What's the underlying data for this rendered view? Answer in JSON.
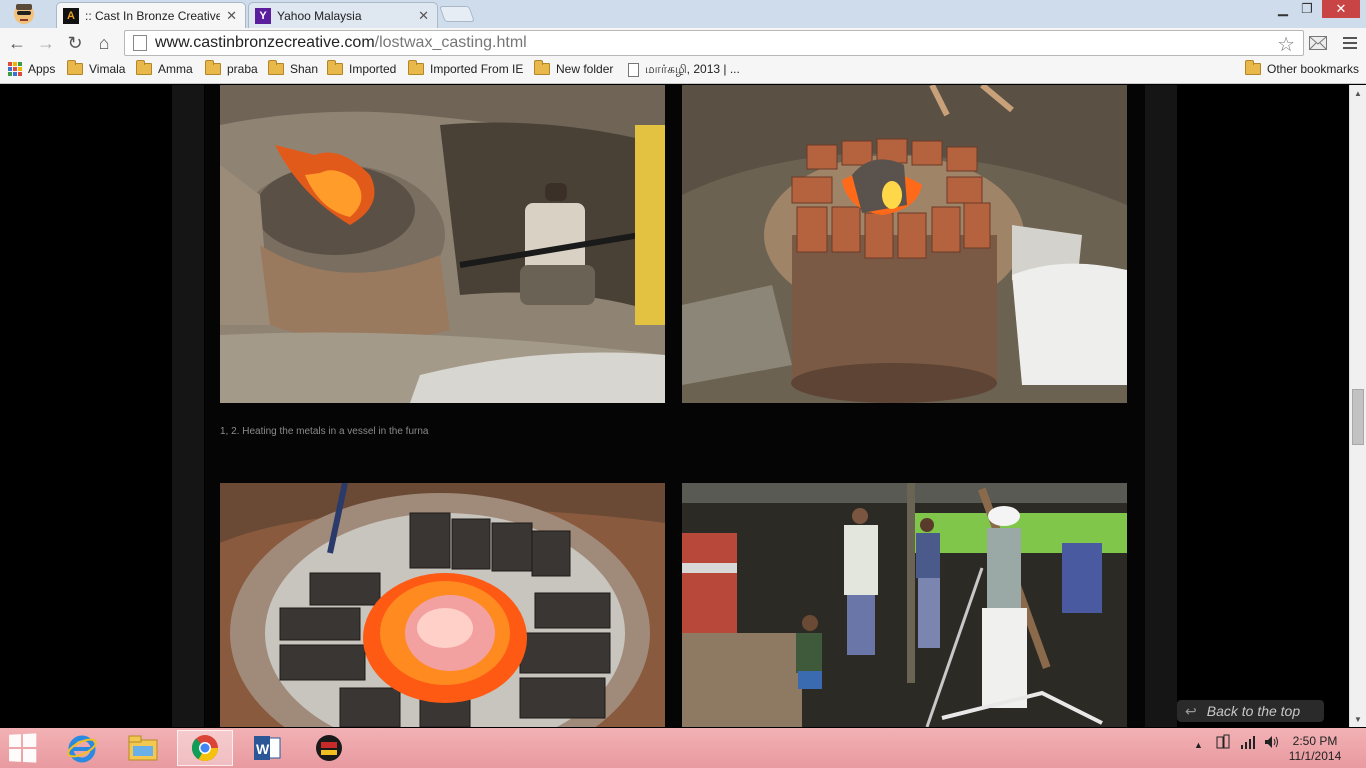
{
  "browser": {
    "tabs": [
      {
        "title": ":: Cast In Bronze Creative ::",
        "active": true
      },
      {
        "title": "Yahoo Malaysia",
        "active": false
      }
    ],
    "url_domain": "www.castinbronzecreative.com",
    "url_path": "/lostwax_casting.html",
    "bookmarks": {
      "apps_label": "Apps",
      "items": [
        "Vimala",
        "Amma",
        "praba",
        "Shan",
        "Imported",
        "Imported From IE",
        "New folder",
        "மார்கழி, 2013 | ..."
      ],
      "other_label": "Other bookmarks"
    }
  },
  "page": {
    "caption": "1, 2. Heating the metals in a vessel in the furna",
    "back_to_top": "Back to the top"
  },
  "taskbar": {
    "time": "2:50 PM",
    "date": "11/1/2014"
  }
}
